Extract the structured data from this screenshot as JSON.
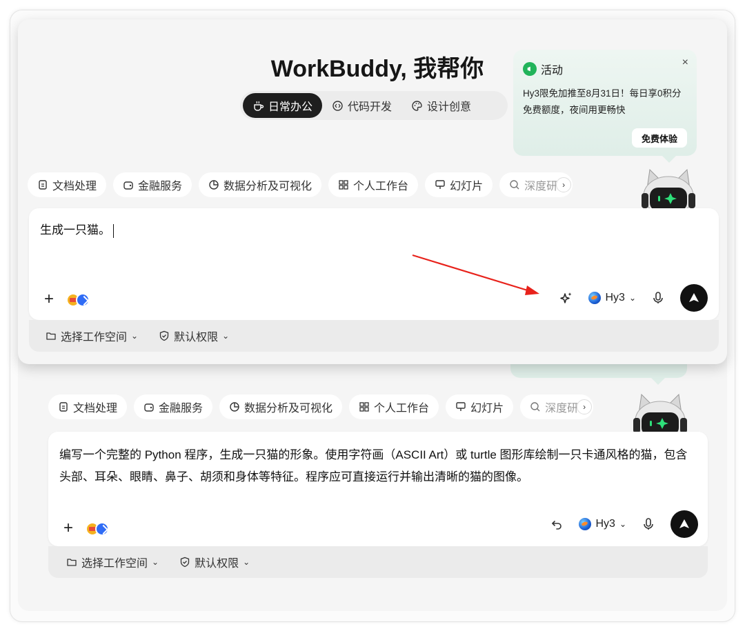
{
  "overlay": {
    "title": "WorkBuddy, 我帮你",
    "mode_tabs": [
      {
        "label": "日常办公",
        "icon": "coffee-icon",
        "active": true
      },
      {
        "label": "代码开发",
        "icon": "code-icon",
        "active": false
      },
      {
        "label": "设计创意",
        "icon": "palette-icon",
        "active": false
      }
    ],
    "promo": {
      "tag": "活动",
      "text": "Hy3限免加推至8月31日！每日享0积分免费额度，夜间用更畅快",
      "button": "免费体验",
      "close": "×"
    },
    "chips": [
      "文档处理",
      "金融服务",
      "数据分析及可视化",
      "个人工作台",
      "幻灯片",
      "深度研"
    ],
    "input": {
      "value": "生成一只猫。"
    },
    "model": "Hy3",
    "workspace_label": "选择工作空间",
    "permission_label": "默认权限"
  },
  "lower": {
    "chips": [
      "文档处理",
      "金融服务",
      "数据分析及可视化",
      "个人工作台",
      "幻灯片",
      "深度研"
    ],
    "input": {
      "value": "编写一个完整的 Python 程序，生成一只猫的形象。使用字符画（ASCII Art）或 turtle 图形库绘制一只卡通风格的猫，包含头部、耳朵、眼睛、鼻子、胡须和身体等特征。程序应可直接运行并输出清晰的猫的图像。"
    },
    "model": "Hy3",
    "workspace_label": "选择工作空间",
    "permission_label": "默认权限"
  },
  "colors": {
    "accent_dark": "#111111",
    "promo_green": "#21b35a",
    "arrow_red": "#e8221b"
  }
}
